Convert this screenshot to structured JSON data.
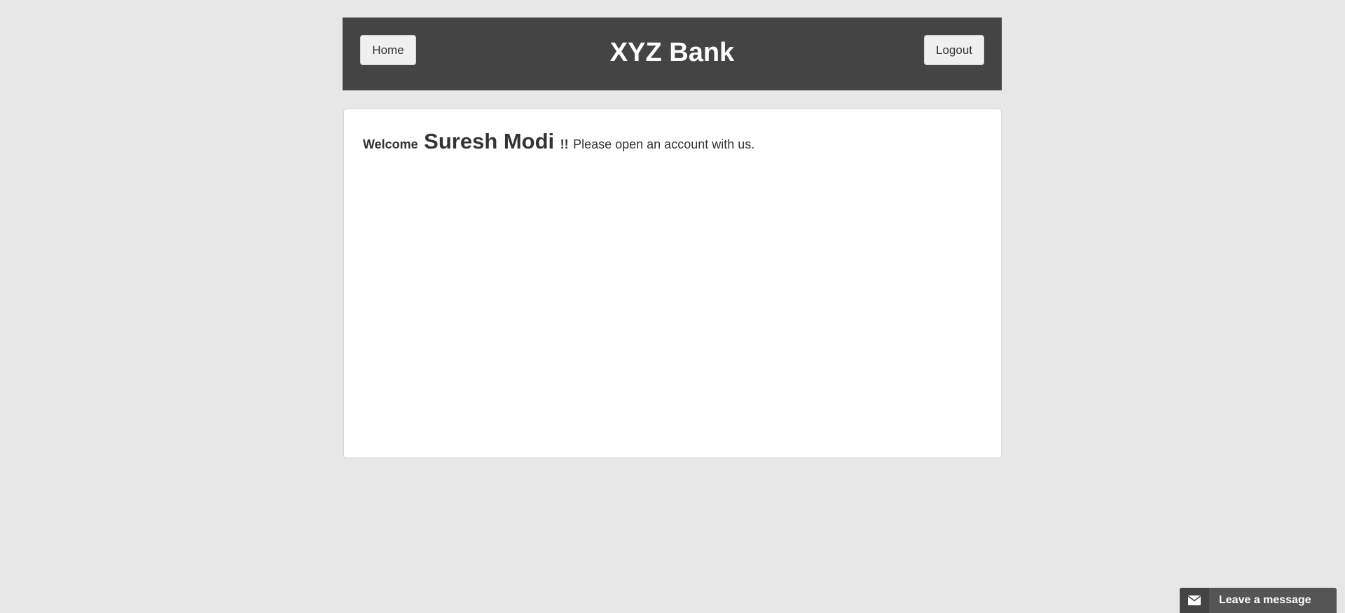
{
  "header": {
    "home_label": "Home",
    "title": "XYZ Bank",
    "logout_label": "Logout"
  },
  "main": {
    "welcome_word": "Welcome",
    "user_name": "Suresh Modi",
    "exclamation": "!!",
    "message": "Please open an account with us."
  },
  "chat_widget": {
    "label": "Leave a message",
    "icon": "envelope-icon"
  },
  "colors": {
    "page_background": "#e7e7e7",
    "header_background": "#444444",
    "panel_background": "#ffffff",
    "widget_background": "#555555"
  }
}
